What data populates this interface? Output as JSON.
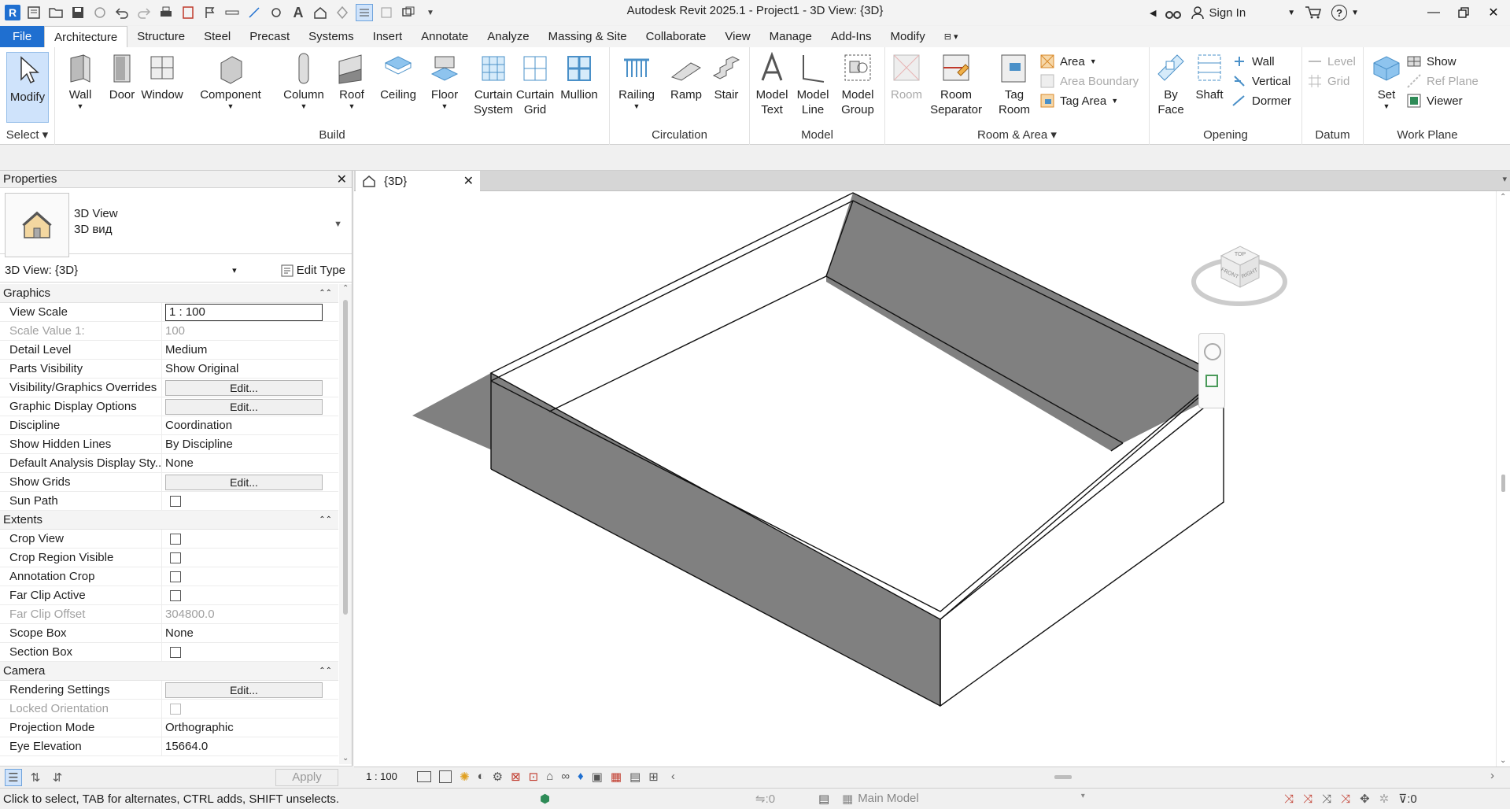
{
  "app": {
    "title": "Autodesk Revit 2025.1 - Project1 - 3D View: {3D}",
    "logo_letter": "R"
  },
  "title_right": {
    "sign_in": "Sign In",
    "help": "?"
  },
  "ribbon_tabs": [
    "File",
    "Architecture",
    "Structure",
    "Steel",
    "Precast",
    "Systems",
    "Insert",
    "Annotate",
    "Analyze",
    "Massing & Site",
    "Collaborate",
    "View",
    "Manage",
    "Add-Ins",
    "Modify"
  ],
  "ribbon": {
    "select": {
      "modify": "Modify",
      "title": "Select"
    },
    "build": {
      "title": "Build",
      "wall": "Wall",
      "door": "Door",
      "window": "Window",
      "component": "Component",
      "column": "Column",
      "roof": "Roof",
      "ceiling": "Ceiling",
      "floor": "Floor",
      "curtain_system": "Curtain System",
      "curtain_grid": "Curtain Grid",
      "mullion": "Mullion"
    },
    "circulation": {
      "title": "Circulation",
      "railing": "Railing",
      "ramp": "Ramp",
      "stair": "Stair"
    },
    "model": {
      "title": "Model",
      "model_text": "Model Text",
      "model_line": "Model Line",
      "model_group": "Model Group"
    },
    "room_area": {
      "title": "Room & Area",
      "room": "Room",
      "room_separator": "Room Separator",
      "tag_room": "Tag Room",
      "area": "Area",
      "area_boundary": "Area  Boundary",
      "tag_area": "Tag  Area"
    },
    "opening": {
      "title": "Opening",
      "by_face": "By Face",
      "shaft": "Shaft",
      "wall": "Wall",
      "vertical": "Vertical",
      "dormer": "Dormer"
    },
    "datum": {
      "title": "Datum",
      "level": "Level",
      "grid": "Grid"
    },
    "work_plane": {
      "title": "Work Plane",
      "set": "Set",
      "show": "Show",
      "ref_plane": "Ref  Plane",
      "viewer": "Viewer"
    }
  },
  "properties": {
    "title": "Properties",
    "type_line1": "3D View",
    "type_line2": "3D вид",
    "instance": "3D View: {3D}",
    "edit_type": "Edit Type",
    "sections": {
      "graphics": "Graphics",
      "extents": "Extents",
      "camera": "Camera"
    },
    "rows": {
      "view_scale": [
        "View Scale",
        "1 : 100"
      ],
      "scale_value": [
        "Scale Value    1:",
        "100"
      ],
      "detail_level": [
        "Detail Level",
        "Medium"
      ],
      "parts_visibility": [
        "Parts Visibility",
        "Show Original"
      ],
      "vg_overrides": [
        "Visibility/Graphics Overrides",
        "Edit..."
      ],
      "graphic_display": [
        "Graphic Display Options",
        "Edit..."
      ],
      "discipline": [
        "Discipline",
        "Coordination"
      ],
      "hidden_lines": [
        "Show Hidden Lines",
        "By Discipline"
      ],
      "analysis_style": [
        "Default Analysis Display Sty...",
        "None"
      ],
      "show_grids": [
        "Show Grids",
        "Edit..."
      ],
      "sun_path": [
        "Sun Path",
        ""
      ],
      "crop_view": [
        "Crop View",
        ""
      ],
      "crop_region": [
        "Crop Region Visible",
        ""
      ],
      "annotation_crop": [
        "Annotation Crop",
        ""
      ],
      "far_clip_active": [
        "Far Clip Active",
        ""
      ],
      "far_clip_offset": [
        "Far Clip Offset",
        "304800.0"
      ],
      "scope_box": [
        "Scope Box",
        "None"
      ],
      "section_box": [
        "Section Box",
        ""
      ],
      "rendering": [
        "Rendering Settings",
        "Edit..."
      ],
      "locked_orientation": [
        "Locked Orientation",
        ""
      ],
      "projection": [
        "Projection Mode",
        "Orthographic"
      ],
      "eye_elevation": [
        "Eye Elevation",
        "15664.0"
      ]
    },
    "apply": "Apply"
  },
  "view_tab": {
    "label": "{3D}"
  },
  "viewcube": {
    "top": "TOP",
    "front": "FRONT",
    "right": "RIGHT"
  },
  "view_control": {
    "scale": "1 : 100"
  },
  "status": {
    "hint": "Click to select, TAB for alternates, CTRL adds, SHIFT unselects.",
    "count1": ":0",
    "model": "Main Model",
    "filter": ":0"
  },
  "colors": {
    "file_tab": "#1f6fd0",
    "wall_shade": "#808080",
    "accent": "#1f6fd0"
  }
}
